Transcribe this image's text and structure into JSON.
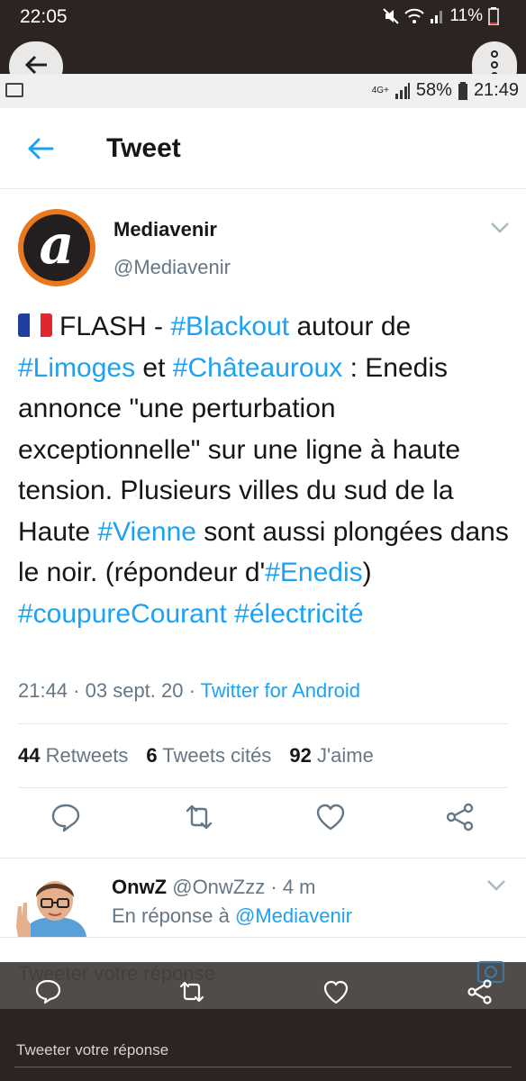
{
  "outer_status": {
    "time": "22:05",
    "battery": "11%"
  },
  "inner_status": {
    "network": "4G+",
    "battery": "58%",
    "time": "21:49"
  },
  "header": {
    "title": "Tweet"
  },
  "tweet": {
    "author_name": "Mediavenir",
    "author_handle": "@Mediavenir",
    "avatar_letter": "a",
    "text_parts": [
      "FLASH - ",
      "#Blackout",
      " autour de ",
      "#Limoges",
      " et ",
      "#Châteauroux",
      " : Enedis annonce \"une perturbation exceptionnelle\" sur une ligne à haute tension. Plusieurs villes du sud de la Haute ",
      "#Vienne",
      " sont aussi plongées dans le noir. (répondeur d'",
      "#Enedis",
      ") ",
      "#coupureCourant",
      " ",
      "#électricité"
    ],
    "time": "21:44",
    "date": "03 sept. 20",
    "source": "Twitter for Android",
    "retweets_count": "44",
    "retweets_label": "Retweets",
    "quotes_count": "6",
    "quotes_label": "Tweets cités",
    "likes_count": "92",
    "likes_label": "J'aime"
  },
  "reply": {
    "name": "OnwZ",
    "handle": "@OnwZzz",
    "age": "4 m",
    "reply_prefix": "En réponse à ",
    "reply_to": "@Mediavenir"
  },
  "compose": {
    "inner_placeholder": "Tweeter votre réponse",
    "outer_placeholder": "Tweeter votre réponse"
  },
  "colors": {
    "accent": "#1da1f2",
    "dark_bar": "#2b2421",
    "avatar_ring": "#e8791e"
  }
}
